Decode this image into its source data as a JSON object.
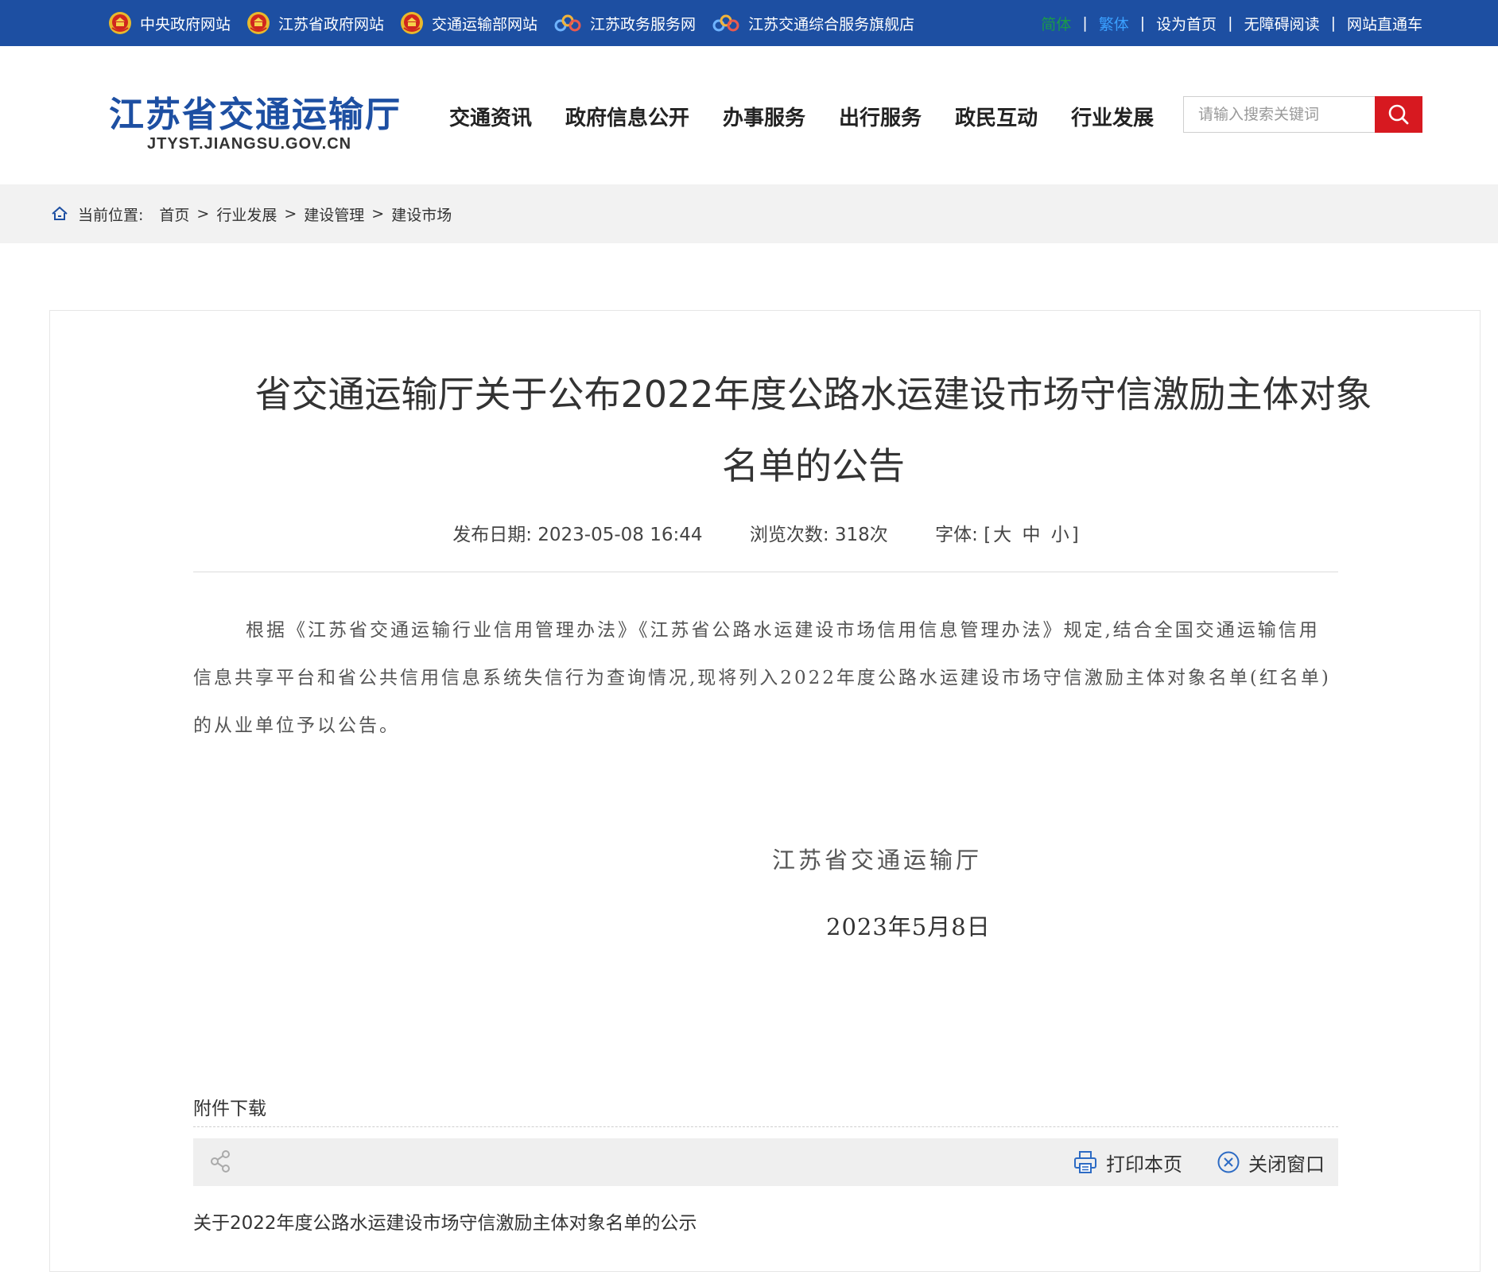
{
  "topbar": {
    "links": [
      {
        "label": "中央政府网站",
        "icon": "national-emblem-icon"
      },
      {
        "label": "江苏省政府网站",
        "icon": "national-emblem-icon"
      },
      {
        "label": "交通运输部网站",
        "icon": "national-emblem-icon"
      },
      {
        "label": "江苏政务服务网",
        "icon": "service-logo-icon"
      },
      {
        "label": "江苏交通综合服务旗舰店",
        "icon": "service-logo-icon"
      }
    ],
    "right": {
      "simplified": "简体",
      "traditional": "繁体",
      "set_home": "设为首页",
      "accessible": "无障碍阅读",
      "direct": "网站直通车"
    },
    "colors": {
      "bar": "#1d4fa2",
      "simplified": "#1a9a4a",
      "traditional": "#3aa0ff"
    }
  },
  "header": {
    "logo_title": "江苏省交通运输厅",
    "logo_domain": "JTYST.JIANGSU.GOV.CN",
    "nav": [
      "交通资讯",
      "政府信息公开",
      "办事服务",
      "出行服务",
      "政民互动",
      "行业发展"
    ],
    "search": {
      "placeholder": "请输入搜索关键词",
      "button_color": "#d71920"
    }
  },
  "breadcrumb": {
    "label": "当前位置:",
    "items": [
      "首页",
      "行业发展",
      "建设管理",
      "建设市场"
    ],
    "separator": ">"
  },
  "article": {
    "title": "省交通运输厅关于公布2022年度公路水运建设市场守信激励主体对象名单的公告",
    "meta": {
      "date_label": "发布日期:",
      "date": "2023-05-08 16:44",
      "views_label": "浏览次数:",
      "views": "318次",
      "font_label": "字体:",
      "font_open": "[",
      "font_large": "大",
      "font_medium": "中",
      "font_small": "小",
      "font_close": "]"
    },
    "body": "根据《江苏省交通运输行业信用管理办法》《江苏省公路水运建设市场信用信息管理办法》规定,结合全国交通运输信用信息共享平台和省公共信用信息系统失信行为查询情况,现将列入2022年度公路水运建设市场守信激励主体对象名单(红名单)的从业单位予以公告。",
    "signature_org": "江苏省交通运输厅",
    "signature_date": "2023年5月8日",
    "attachment_label": "附件下载",
    "tools": {
      "print": "打印本页",
      "close": "关闭窗口"
    },
    "attachment_link": "关于2022年度公路水运建设市场守信激励主体对象名单的公示"
  }
}
